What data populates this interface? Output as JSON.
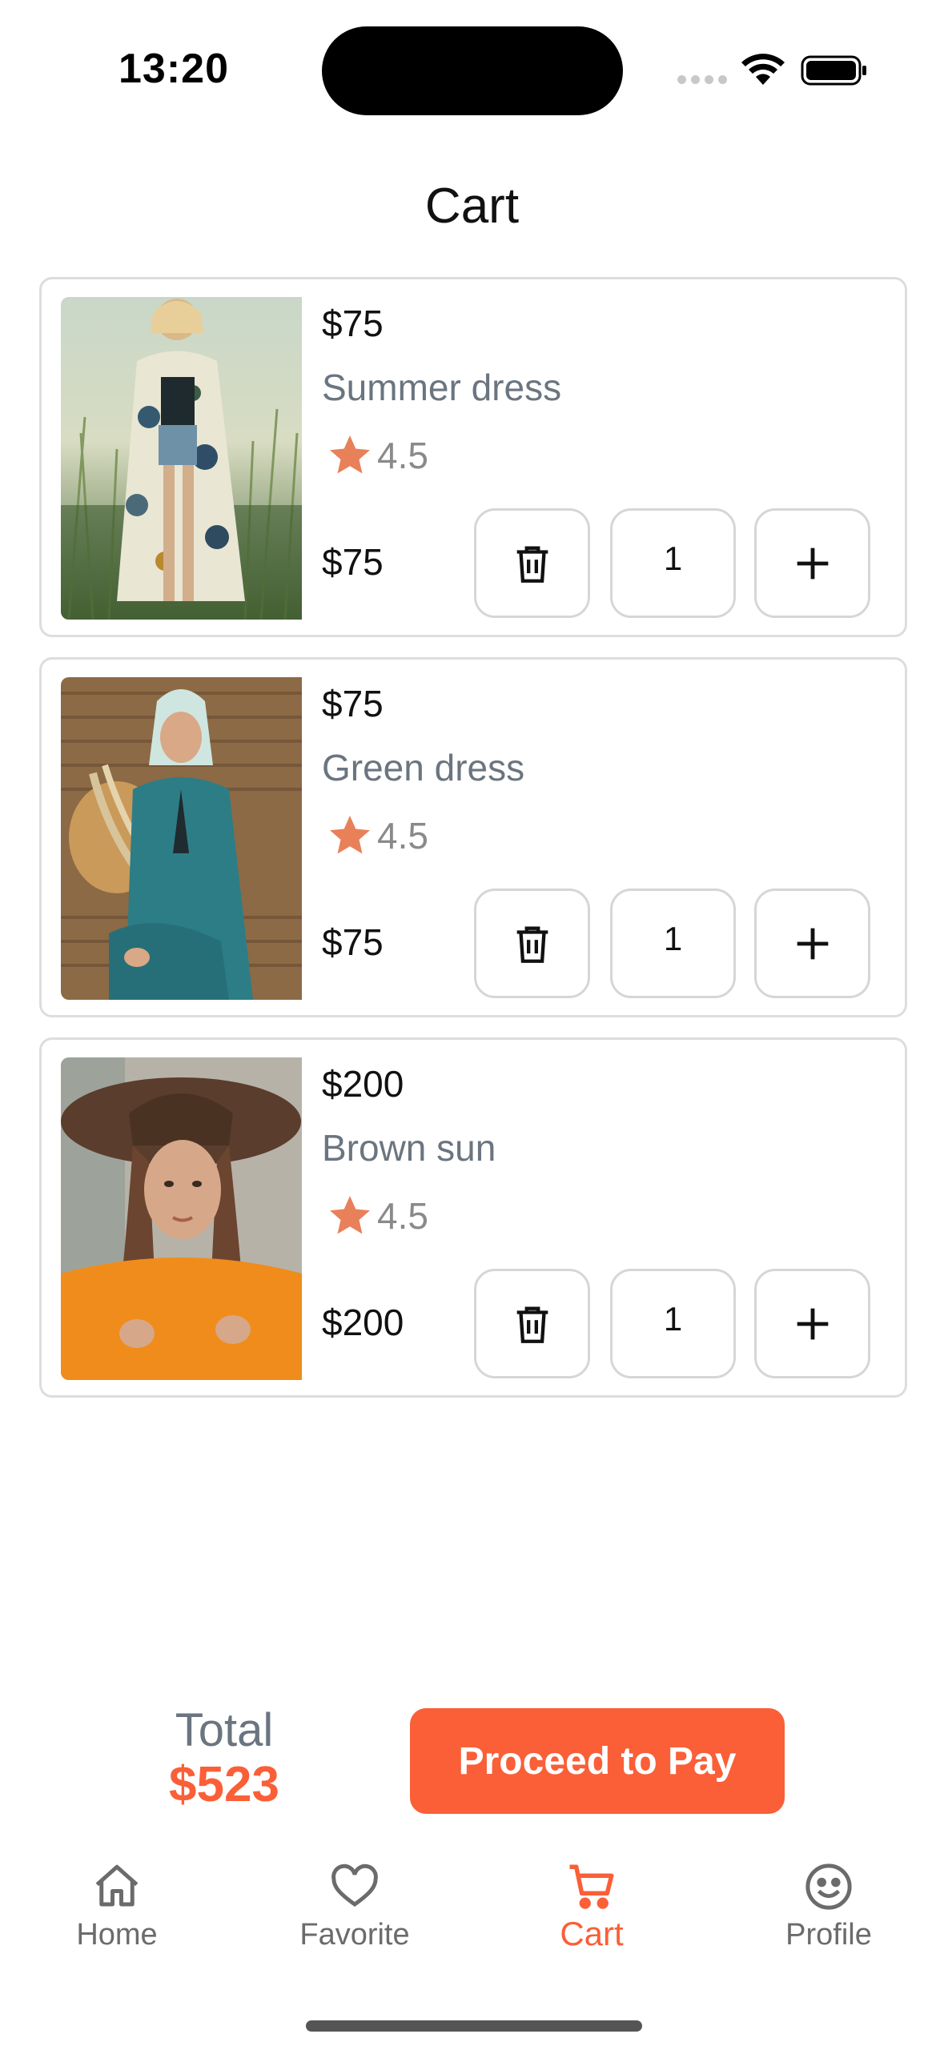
{
  "status_bar": {
    "time": "13:20"
  },
  "header": {
    "title": "Cart"
  },
  "cart": {
    "items": [
      {
        "price": "$75",
        "name": "Summer dress",
        "rating": "4.5",
        "subtotal": "$75",
        "quantity": "1"
      },
      {
        "price": "$75",
        "name": "Green dress",
        "rating": "4.5",
        "subtotal": "$75",
        "quantity": "1"
      },
      {
        "price": "$200",
        "name": "Brown sun",
        "rating": "4.5",
        "subtotal": "$200",
        "quantity": "1"
      }
    ]
  },
  "summary": {
    "total_label": "Total",
    "total_value": "$523",
    "pay_label": "Proceed to Pay"
  },
  "nav": {
    "items": [
      {
        "label": "Home",
        "icon": "home-icon"
      },
      {
        "label": "Favorite",
        "icon": "heart-icon"
      },
      {
        "label": "Cart",
        "icon": "cart-icon",
        "active": true
      },
      {
        "label": "Profile",
        "icon": "smiley-icon"
      }
    ]
  },
  "colors": {
    "accent": "#fa5f38",
    "star": "#e8805a",
    "muted_text": "#6b7580",
    "border": "#dddddd"
  }
}
